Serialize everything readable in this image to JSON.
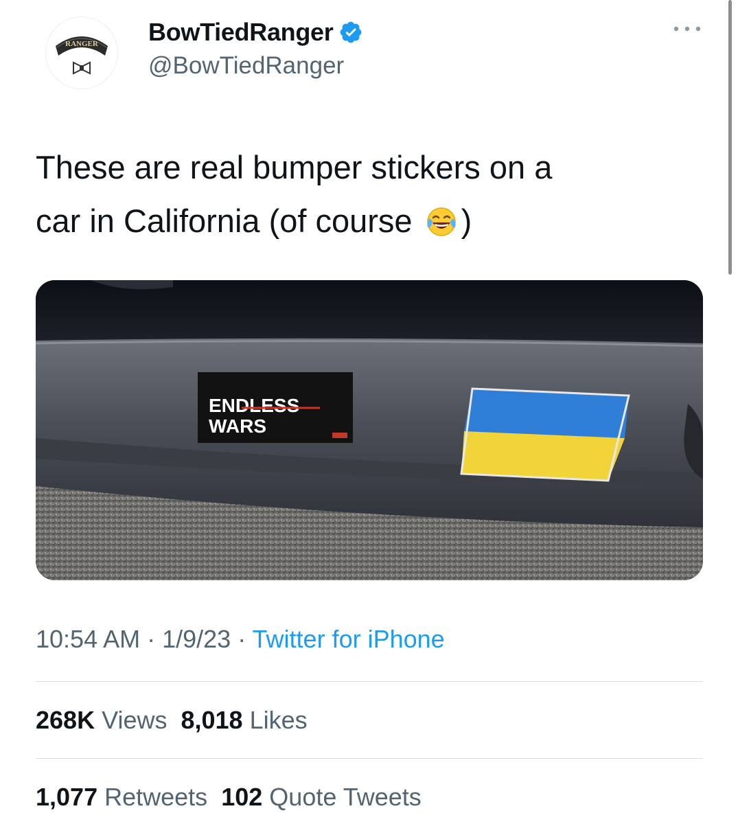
{
  "user": {
    "display_name": "BowTiedRanger",
    "handle": "@BowTiedRanger",
    "avatar_tab_text": "RANGER",
    "verified": true
  },
  "tweet": {
    "text_line1": "These are real bumper stickers on a",
    "text_line2_before": "car in California (of course",
    "emoji": "face-with-tears-of-joy",
    "text_line2_after": ")",
    "image": {
      "sticker_1_line1": "ENDLESS",
      "sticker_1_line2": "WARS",
      "sticker_2": "ukraine-flag",
      "flag_colors": [
        "#2f7fd8",
        "#f0d43a"
      ]
    }
  },
  "meta": {
    "time": "10:54 AM",
    "separator": " · ",
    "date": "1/9/23",
    "source": "Twitter for iPhone"
  },
  "stats": {
    "views_count": "268K",
    "views_label": "Views",
    "likes_count": "8,018",
    "likes_label": "Likes",
    "retweets_count": "1,077",
    "retweets_label": "Retweets",
    "quotes_count": "102",
    "quotes_label": "Quote Tweets"
  },
  "colors": {
    "text": "#0f1419",
    "secondary": "#536471",
    "accent": "#1d9bf0"
  }
}
